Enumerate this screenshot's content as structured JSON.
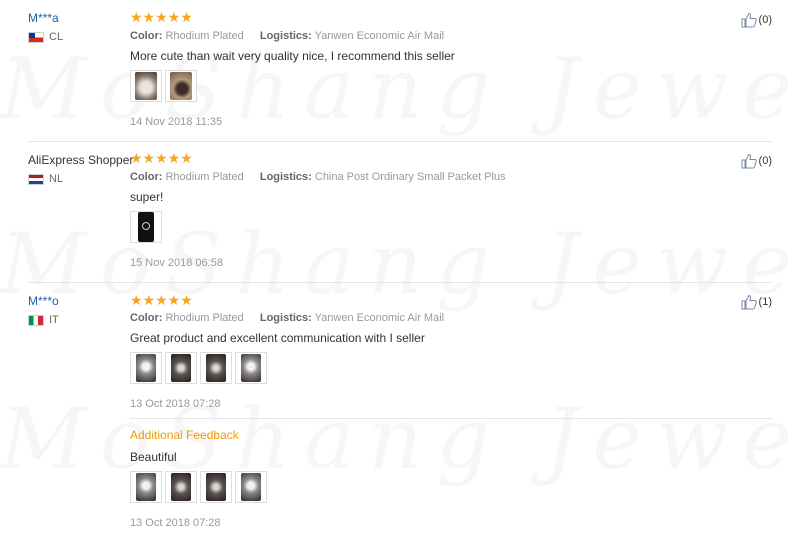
{
  "watermark": "MoShang Jewelry",
  "reviews": [
    {
      "user": "M***a",
      "country_code": "CL",
      "rating_stars": "★★★★★",
      "rating": 5,
      "color_label": "Color:",
      "color_value": "Rhodium Plated",
      "logistics_label": "Logistics:",
      "logistics_value": "Yanwen Economic Air Mail",
      "text": "More cute than wait very quality nice, I recommend this seller",
      "date": "14 Nov 2018 11:35",
      "helpful": "(0)",
      "photo_count": 2
    },
    {
      "user": "AliExpress Shopper",
      "country_code": "NL",
      "rating_stars": "★★★★★",
      "rating": 5,
      "color_label": "Color:",
      "color_value": "Rhodium Plated",
      "logistics_label": "Logistics:",
      "logistics_value": "China Post Ordinary Small Packet Plus",
      "text": "super!",
      "date": "15 Nov 2018 06:58",
      "helpful": "(0)",
      "photo_count": 1
    },
    {
      "user": "M***o",
      "country_code": "IT",
      "rating_stars": "★★★★★",
      "rating": 5,
      "color_label": "Color:",
      "color_value": "Rhodium Plated",
      "logistics_label": "Logistics:",
      "logistics_value": "Yanwen Economic Air Mail",
      "text": "Great product and excellent communication with I seller",
      "date": "13 Oct 2018 07:28",
      "helpful": "(1)",
      "photo_count": 4,
      "additional_feedback": {
        "label": "Additional Feedback",
        "text": "Beautiful",
        "date": "13 Oct 2018 07:28",
        "photo_count": 4
      }
    }
  ],
  "colors": {
    "star": "#f5a623",
    "masked_user": "#1a5fa8",
    "additional_feedback": "#f29b00"
  },
  "icons": {
    "helpful": "thumbs-up-icon",
    "rating": "star-icon"
  }
}
